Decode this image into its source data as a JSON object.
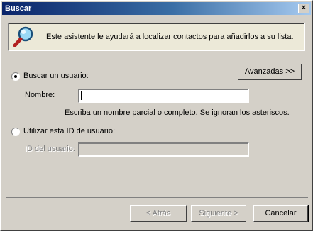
{
  "window": {
    "title": "Buscar",
    "close_glyph": "×"
  },
  "info": {
    "text": "Este asistente le ayudará a localizar contactos para añadirlos a su lista.",
    "icon": "magnifier-icon"
  },
  "search_user": {
    "radio_label": "Buscar un usuario:",
    "selected": true,
    "name_label": "Nombre:",
    "name_value": "",
    "hint": "Escriba un nombre parcial o completo. Se ignoran los asteriscos.",
    "advanced_button": "Avanzadas >>"
  },
  "use_id": {
    "radio_label": "Utilizar esta ID de usuario:",
    "selected": false,
    "id_label": "ID del usuario:",
    "id_value": ""
  },
  "buttons": {
    "back": "< Atrás",
    "next": "Siguiente >",
    "cancel": "Cancelar"
  }
}
